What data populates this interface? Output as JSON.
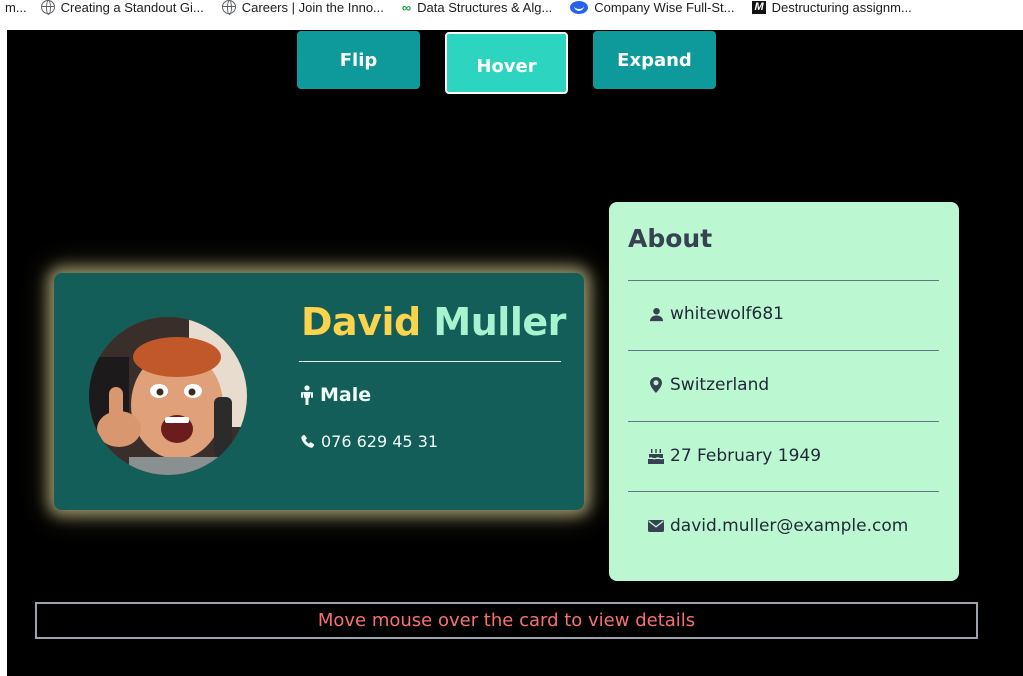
{
  "bookmarks": [
    {
      "label": "m...",
      "icon": "none"
    },
    {
      "label": "Creating a Standout Gi...",
      "icon": "globe-icon"
    },
    {
      "label": "Careers | Join the Inno...",
      "icon": "globe-icon"
    },
    {
      "label": "Data Structures & Alg...",
      "icon": "glasses-icon"
    },
    {
      "label": "Company Wise Full-St...",
      "icon": "chat-bubble-icon"
    },
    {
      "label": "Destructuring assignm...",
      "icon": "m-logo-icon"
    }
  ],
  "modes": {
    "flip": "Flip",
    "hover": "Hover",
    "expand": "Expand"
  },
  "profile": {
    "first_name": "David",
    "last_name": "Muller",
    "gender": "Male",
    "phone": "076 629 45 31"
  },
  "about": {
    "title": "About",
    "username": "whitewolf681",
    "country": "Switzerland",
    "birthday": "27 February 1949",
    "email": "david.muller@example.com"
  },
  "hint": "Move mouse over the card to view details",
  "colors": {
    "background": "#000000",
    "button": "#0e9a9a",
    "button_active": "#2dd4bf",
    "card": "#135e58",
    "first_name": "#fcd34d",
    "last_name": "#a7f3d0",
    "about_panel": "#bbf7d0",
    "hint_text": "#f87171"
  }
}
